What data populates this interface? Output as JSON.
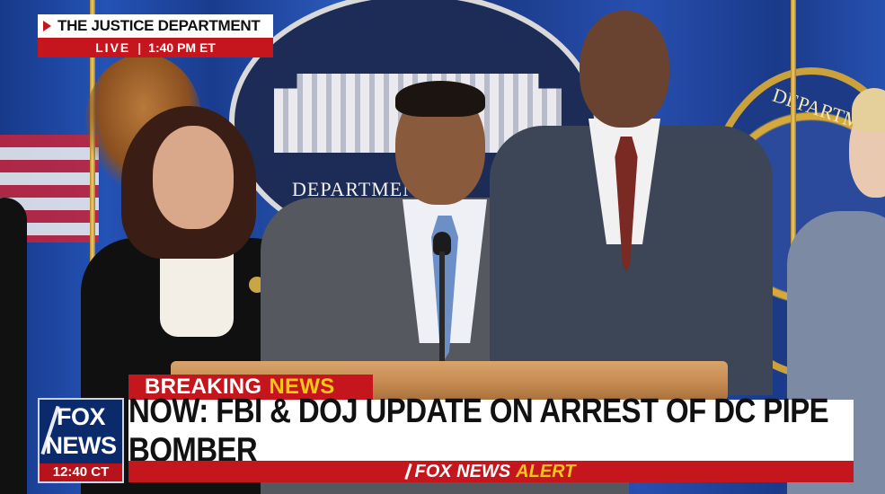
{
  "top_bug": {
    "title": "THE JUSTICE DEPARTMENT",
    "live_label": "LIVE",
    "separator": "|",
    "time": "1:40 PM ET"
  },
  "backdrop": {
    "doj_seal_text": "DEPARTMENT OF",
    "fbi_seal_text": "DEPARTM"
  },
  "chyron": {
    "breaking_label": "BREAKING",
    "news_label": "NEWS",
    "headline": "NOW: FBI & DOJ UPDATE ON ARREST OF DC PIPE BOMBER",
    "alert_brand": "FOX NEWS",
    "alert_word": "ALERT"
  },
  "network_logo": {
    "fox": "FOX",
    "news": "NEWS",
    "time": "12:40 CT"
  },
  "colors": {
    "fox_red": "#c4161c",
    "fox_yellow": "#f5c518",
    "fox_blue": "#0b2a6b"
  }
}
